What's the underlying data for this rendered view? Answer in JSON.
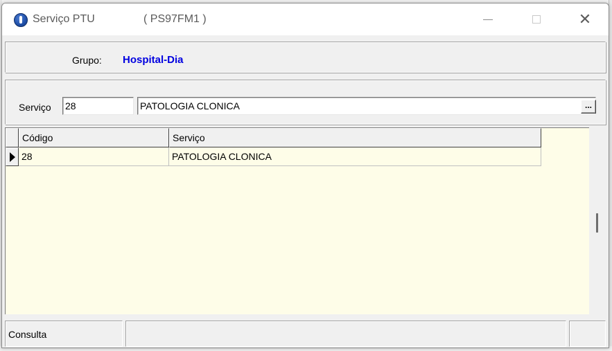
{
  "window": {
    "title": "Serviço PTU",
    "code": "( PS97FM1 )",
    "minimize_label": "—",
    "maximize_label": "☐",
    "close_label": "✕"
  },
  "grupo": {
    "label": "Grupo:",
    "value": "Hospital-Dia",
    "value_color": "#0000e0"
  },
  "servico": {
    "label": "Serviço",
    "code_value": "28",
    "name_value": "PATOLOGIA CLONICA",
    "lookup_label": "..."
  },
  "grid": {
    "columns": [
      "Código",
      "Serviço"
    ],
    "rows": [
      {
        "codigo": "28",
        "servico": "PATOLOGIA CLONICA",
        "selected": true
      }
    ],
    "background": "#fefde8"
  },
  "statusbar": {
    "mode": "Consulta",
    "message": "",
    "extra": ""
  }
}
